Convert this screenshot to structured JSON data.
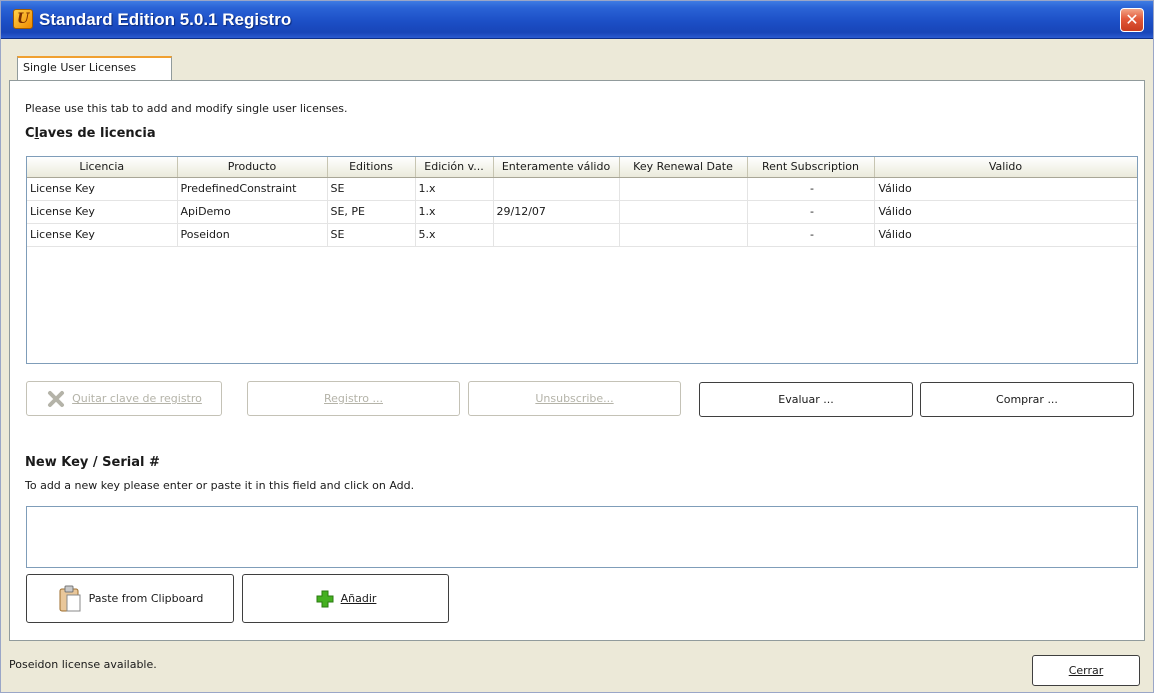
{
  "window": {
    "title": "Standard Edition 5.0.1 Registro",
    "icon": "app-logo-icon",
    "close_icon": "close-icon",
    "close_glyph": "✕"
  },
  "tab": {
    "label": "Single User Licenses"
  },
  "intro_text": "Please use this tab to add and modify single user licenses.",
  "licenses": {
    "title": "Claves de licencia",
    "columns": [
      "Licencia",
      "Producto",
      "Editions",
      "Edición v...",
      "Enteramente válido",
      "Key Renewal Date",
      "Rent Subscription",
      "Valido"
    ],
    "rows": [
      [
        "License Key",
        "PredefinedConstraint",
        "SE",
        "1.x",
        "",
        "",
        "-",
        "Válido"
      ],
      [
        "License Key",
        "ApiDemo",
        "SE, PE",
        "1.x",
        "29/12/07",
        "",
        "-",
        "Válido"
      ],
      [
        "License Key",
        "Poseidon",
        "SE",
        "5.x",
        "",
        "",
        "-",
        "Válido"
      ]
    ]
  },
  "actions": {
    "remove": {
      "label": "Quitar clave de registro",
      "icon": "remove-key-icon",
      "enabled": false
    },
    "register": {
      "label": "Registro ...",
      "enabled": false
    },
    "unsubscribe": {
      "label": "Unsubscribe...",
      "enabled": false
    },
    "evaluate": {
      "label": "Evaluar ...",
      "enabled": true
    },
    "buy": {
      "label": "Comprar ...",
      "enabled": true
    }
  },
  "new_key": {
    "title": "New Key / Serial #",
    "hint": "To add a new key please enter or paste it in this field and click on Add.",
    "value": "",
    "paste": {
      "label": "Paste from Clipboard",
      "icon": "clipboard-icon"
    },
    "add": {
      "label": "Añadir",
      "icon": "plus-icon"
    }
  },
  "status_text": "Poseidon license available.",
  "close_label": "Cerrar",
  "colors": {
    "title_bar": "#1c4fc6",
    "close_button": "#e2593a",
    "tab_highlight": "#f0a030",
    "add_icon": "#44b020"
  }
}
